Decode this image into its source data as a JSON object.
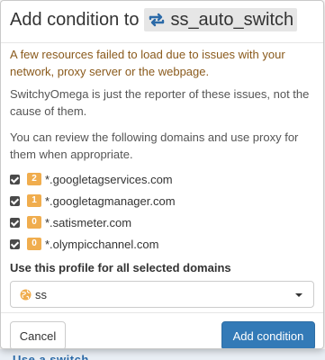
{
  "background_snippet": "Use a switch",
  "dialog": {
    "title_prefix": "Add condition to",
    "profile_name": "ss_auto_switch",
    "profile_icon": "switch-arrows-icon",
    "warning": "A few resources failed to load due to issues with your network, proxy server or the webpage.",
    "reporter_note": "SwitchyOmega is just the reporter of these issues, not the cause of them.",
    "review_note": "You can review the following domains and use proxy for them when appropriate.",
    "domains": [
      {
        "checked": true,
        "count": "2",
        "domain": "*.googletagservices.com"
      },
      {
        "checked": true,
        "count": "1",
        "domain": "*.googletagmanager.com"
      },
      {
        "checked": true,
        "count": "0",
        "domain": "*.satismeter.com"
      },
      {
        "checked": true,
        "count": "0",
        "domain": "*.olympicchannel.com"
      }
    ],
    "use_profile_label": "Use this profile for all selected domains",
    "profile_select": {
      "icon": "globe-icon",
      "value": "ss"
    },
    "cancel_label": "Cancel",
    "add_label": "Add condition"
  },
  "colors": {
    "primary": "#337ab7",
    "badge": "#f0ad4e",
    "warning_text": "#8a5a1c",
    "profile_icon": "#2b6aa8",
    "globe": "#f0ad4e"
  }
}
